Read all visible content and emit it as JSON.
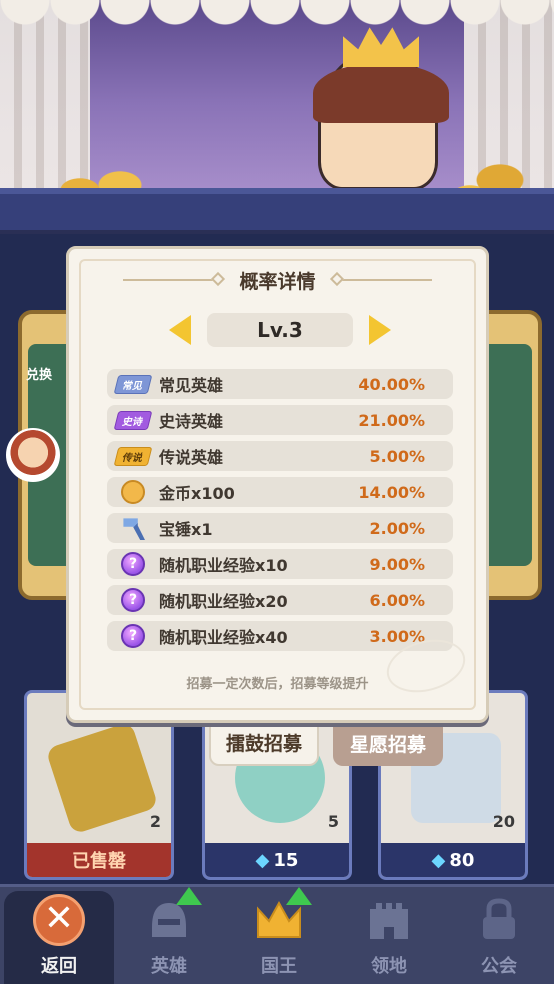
{
  "modal": {
    "title": "概率详情",
    "level_label": "Lv.3",
    "footnote": "招募一定次数后，招募等级提升",
    "rows": [
      {
        "icon": "tag-common-icon",
        "tag": "常见",
        "name": "常见英雄",
        "percent": "40.00%"
      },
      {
        "icon": "tag-epic-icon",
        "tag": "史诗",
        "name": "史诗英雄",
        "percent": "21.00%"
      },
      {
        "icon": "tag-legend-icon",
        "tag": "传说",
        "name": "传说英雄",
        "percent": "5.00%"
      },
      {
        "icon": "coin-icon",
        "tag": "",
        "name": "金币x100",
        "percent": "14.00%"
      },
      {
        "icon": "hammer-icon",
        "tag": "",
        "name": "宝锤x1",
        "percent": "2.00%"
      },
      {
        "icon": "mystery-orb-icon",
        "tag": "",
        "name": "随机职业经验x10",
        "percent": "9.00%"
      },
      {
        "icon": "mystery-orb-icon",
        "tag": "",
        "name": "随机职业经验x20",
        "percent": "6.00%"
      },
      {
        "icon": "mystery-orb-icon",
        "tag": "",
        "name": "随机职业经验x40",
        "percent": "3.00%"
      }
    ],
    "question_glyph": "?"
  },
  "modes": {
    "drum": "擂鼓招募",
    "wish": "星愿招募"
  },
  "shop": {
    "card1": {
      "count": "2",
      "banner": "已售罄"
    },
    "card2": {
      "count": "5",
      "price": "15"
    },
    "card3": {
      "count": "20",
      "price": "80"
    },
    "gem_glyph": "◆"
  },
  "side": {
    "exchange": "兑换"
  },
  "nav": {
    "back": "返回",
    "heroes": "英雄",
    "king": "国王",
    "territory": "领地",
    "guild": "公会",
    "close_glyph": "✕"
  },
  "colors": {
    "accent": "#d06a1a",
    "arrow": "#f3c531",
    "nav_bg": "#3d4466",
    "modal_bg": "#f7f3eb"
  }
}
